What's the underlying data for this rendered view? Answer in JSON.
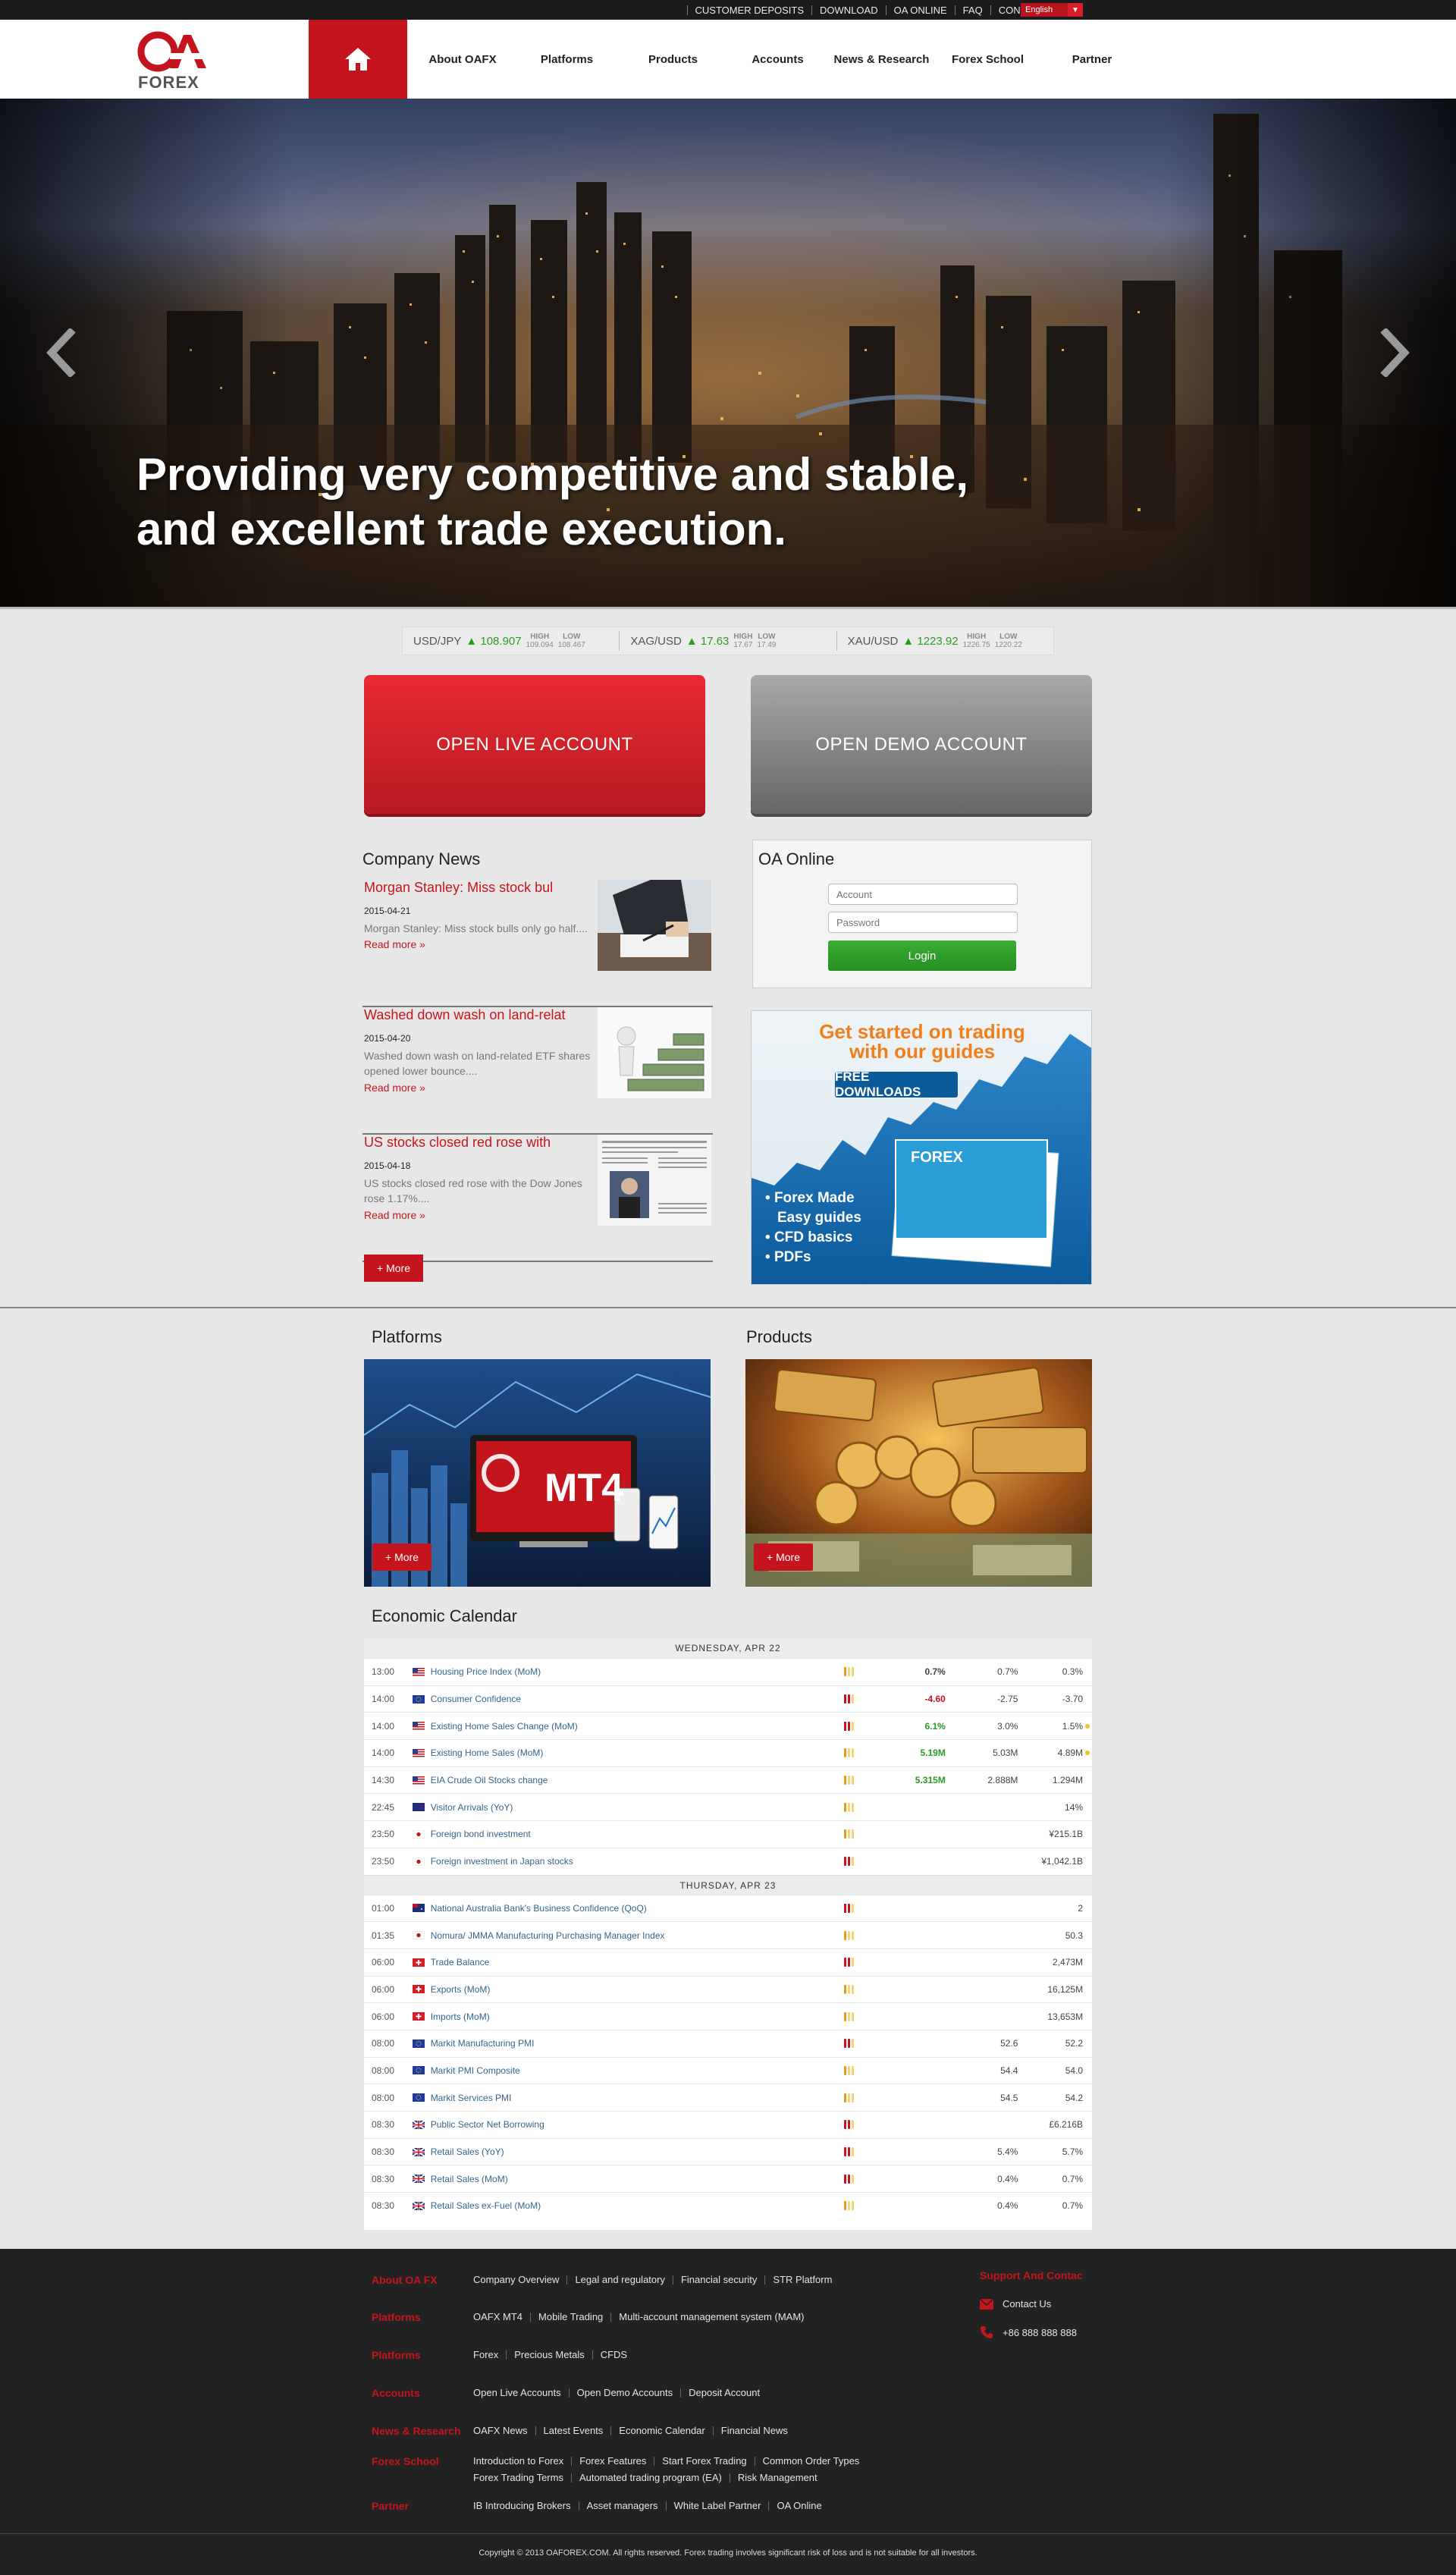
{
  "topbar": {
    "links": [
      "CUSTOMER DEPOSITS",
      "DOWNLOAD",
      "OA ONLINE",
      "FAQ",
      "CONTACT US"
    ],
    "language": "English"
  },
  "brand": {
    "logo_mark": "OA",
    "logo_text": "FOREX",
    "color": "#c4141d"
  },
  "nav": {
    "items": [
      "About OAFX",
      "Platforms",
      "Products",
      "Accounts",
      "News & Research",
      "Forex School",
      "Partner"
    ]
  },
  "hero": {
    "line1": "Providing very competitive and stable,",
    "line2": "and excellent trade execution."
  },
  "ticker": [
    {
      "symbol": "USD/JPY",
      "value": "108.907",
      "high_label": "HIGH",
      "high": "109.094",
      "low_label": "LOW",
      "low": "108.467"
    },
    {
      "symbol": "XAG/USD",
      "value": "17.63",
      "high_label": "HIGH",
      "high": "17.67",
      "low_label": "LOW",
      "low": "17.49"
    },
    {
      "symbol": "XAU/USD",
      "value": "1223.92",
      "high_label": "HIGH",
      "high": "1226.75",
      "low_label": "LOW",
      "low": "1220.22"
    }
  ],
  "accounts": {
    "live": "OPEN LIVE ACCOUNT",
    "demo": "OPEN DEMO ACCOUNT"
  },
  "news": {
    "title": "Company News",
    "more": "+ More",
    "items": [
      {
        "title": "Morgan Stanley: Miss stock bul",
        "date": "2015-04-21",
        "excerpt": "Morgan Stanley: Miss stock bulls only go half....",
        "read_more": "Read more »"
      },
      {
        "title": "Washed down wash on land-relat",
        "date": "2015-04-20",
        "excerpt": "Washed down wash on land-related ETF shares opened lower bounce....",
        "read_more": "Read more »"
      },
      {
        "title": "US stocks closed red rose with",
        "date": "2015-04-18",
        "excerpt": "US stocks closed red rose with the Dow Jones rose 1.17%....",
        "read_more": "Read more »"
      }
    ]
  },
  "oa_online": {
    "title": "OA Online",
    "account_placeholder": "Account",
    "password_placeholder": "Password",
    "login": "Login"
  },
  "promo": {
    "headline1": "Get started on trading",
    "headline2": "with our guides",
    "button": "FREE DOWNLOADS",
    "book": "FOREX",
    "bullets": [
      "Forex Made",
      "Easy guides",
      "CFD basics",
      "PDFs"
    ]
  },
  "platforms": {
    "title": "Platforms",
    "badge": "MT4",
    "more": "+ More"
  },
  "products": {
    "title": "Products",
    "more": "+ More"
  },
  "calendar": {
    "title": "Economic Calendar",
    "days": [
      {
        "label": "WEDNESDAY, APR 22",
        "rows": [
          {
            "time": "13:00",
            "flag": "us",
            "event": "Housing Price Index (MoM)",
            "imp": 1,
            "actual": "0.7%",
            "actual_color": "#444444",
            "forecast": "0.7%",
            "previous": "0.3%",
            "dot": false
          },
          {
            "time": "14:00",
            "flag": "eu",
            "event": "Consumer Confidence",
            "imp": 2,
            "actual": "-4.60",
            "actual_color": "#c4141d",
            "forecast": "-2.75",
            "previous": "-3.70",
            "dot": false
          },
          {
            "time": "14:00",
            "flag": "us",
            "event": "Existing Home Sales Change (MoM)",
            "imp": 2,
            "actual": "6.1%",
            "actual_color": "#2b9b22",
            "forecast": "3.0%",
            "previous": "1.5%",
            "dot": true
          },
          {
            "time": "14:00",
            "flag": "us",
            "event": "Existing Home Sales (MoM)",
            "imp": 1,
            "actual": "5.19M",
            "actual_color": "#2b9b22",
            "forecast": "5.03M",
            "previous": "4.89M",
            "dot": true
          },
          {
            "time": "14:30",
            "flag": "us",
            "event": "EIA Crude Oil Stocks change",
            "imp": 1,
            "actual": "5.315M",
            "actual_color": "#2b9b22",
            "forecast": "2.888M",
            "previous": "1.294M",
            "dot": false
          },
          {
            "time": "22:45",
            "flag": "nz",
            "event": "Visitor Arrivals (YoY)",
            "imp": 1,
            "actual": "",
            "actual_color": "#444444",
            "forecast": "",
            "previous": "14%",
            "dot": false
          },
          {
            "time": "23:50",
            "flag": "jp",
            "event": "Foreign bond investment",
            "imp": 1,
            "actual": "",
            "actual_color": "#444444",
            "forecast": "",
            "previous": "¥215.1B",
            "dot": false
          },
          {
            "time": "23:50",
            "flag": "jp",
            "event": "Foreign investment in Japan stocks",
            "imp": 2,
            "actual": "",
            "actual_color": "#444444",
            "forecast": "",
            "previous": "¥1,042.1B",
            "dot": false
          }
        ]
      },
      {
        "label": "THURSDAY, APR 23",
        "rows": [
          {
            "time": "01:00",
            "flag": "au",
            "event": "National Australia Bank's Business Confidence (QoQ)",
            "imp": 2,
            "actual": "",
            "actual_color": "#444444",
            "forecast": "",
            "previous": "2",
            "dot": false
          },
          {
            "time": "01:35",
            "flag": "jp",
            "event": "Nomura/ JMMA Manufacturing Purchasing Manager Index",
            "imp": 1,
            "actual": "",
            "actual_color": "#444444",
            "forecast": "",
            "previous": "50.3",
            "dot": false
          },
          {
            "time": "06:00",
            "flag": "ch",
            "event": "Trade Balance",
            "imp": 2,
            "actual": "",
            "actual_color": "#444444",
            "forecast": "",
            "previous": "2,473M",
            "dot": false
          },
          {
            "time": "06:00",
            "flag": "ch",
            "event": "Exports (MoM)",
            "imp": 1,
            "actual": "",
            "actual_color": "#444444",
            "forecast": "",
            "previous": "16,125M",
            "dot": false
          },
          {
            "time": "06:00",
            "flag": "ch",
            "event": "Imports (MoM)",
            "imp": 1,
            "actual": "",
            "actual_color": "#444444",
            "forecast": "",
            "previous": "13,653M",
            "dot": false
          },
          {
            "time": "08:00",
            "flag": "eu",
            "event": "Markit Manufacturing PMI",
            "imp": 2,
            "actual": "",
            "actual_color": "#444444",
            "forecast": "52.6",
            "previous": "52.2",
            "dot": false
          },
          {
            "time": "08:00",
            "flag": "eu",
            "event": "Markit PMI Composite",
            "imp": 1,
            "actual": "",
            "actual_color": "#444444",
            "forecast": "54.4",
            "previous": "54.0",
            "dot": false
          },
          {
            "time": "08:00",
            "flag": "eu",
            "event": "Markit Services PMI",
            "imp": 1,
            "actual": "",
            "actual_color": "#444444",
            "forecast": "54.5",
            "previous": "54.2",
            "dot": false
          },
          {
            "time": "08:30",
            "flag": "gb",
            "event": "Public Sector Net Borrowing",
            "imp": 2,
            "actual": "",
            "actual_color": "#444444",
            "forecast": "",
            "previous": "£6.216B",
            "dot": false
          },
          {
            "time": "08:30",
            "flag": "gb",
            "event": "Retail Sales (YoY)",
            "imp": 2,
            "actual": "",
            "actual_color": "#444444",
            "forecast": "5.4%",
            "previous": "5.7%",
            "dot": false
          },
          {
            "time": "08:30",
            "flag": "gb",
            "event": "Retail Sales (MoM)",
            "imp": 2,
            "actual": "",
            "actual_color": "#444444",
            "forecast": "0.4%",
            "previous": "0.7%",
            "dot": false
          },
          {
            "time": "08:30",
            "flag": "gb",
            "event": "Retail Sales ex-Fuel (MoM)",
            "imp": 1,
            "actual": "",
            "actual_color": "#444444",
            "forecast": "0.4%",
            "previous": "0.7%",
            "dot": false
          }
        ]
      }
    ]
  },
  "footer": {
    "rows": [
      {
        "heading": "About OA FX",
        "links": [
          "Company Overview",
          "Legal and regulatory",
          "Financial security",
          "STR Platform"
        ]
      },
      {
        "heading": "Platforms",
        "links": [
          "OAFX MT4",
          "Mobile Trading",
          "Multi-account management system (MAM)"
        ]
      },
      {
        "heading": "Platforms",
        "links": [
          "Forex",
          "Precious Metals",
          "CFDS"
        ]
      },
      {
        "heading": "Accounts",
        "links": [
          "Open Live Accounts",
          "Open Demo Accounts",
          "Deposit Account"
        ]
      },
      {
        "heading": "News & Research",
        "links": [
          "OAFX News",
          "Latest Events",
          "Economic Calendar",
          "Financial News"
        ]
      },
      {
        "heading": "Forex School",
        "links": [
          "Introduction to Forex",
          "Forex Features",
          "Start Forex Trading",
          "Common Order Types"
        ],
        "links2": [
          "Forex Trading Terms",
          "Automated trading program (EA)",
          "Risk Management"
        ]
      },
      {
        "heading": "Partner",
        "links": [
          "IB Introducing Brokers",
          "Asset managers",
          "White Label Partner",
          "OA Online"
        ]
      }
    ],
    "support": {
      "heading": "Support And Contac",
      "contact": "Contact Us",
      "phone": "+86 888 888 888"
    },
    "copyright": "Copyright © 2013 OAFOREX.COM. All rights reserved. Forex trading involves significant risk of loss and is not suitable for all investors."
  }
}
